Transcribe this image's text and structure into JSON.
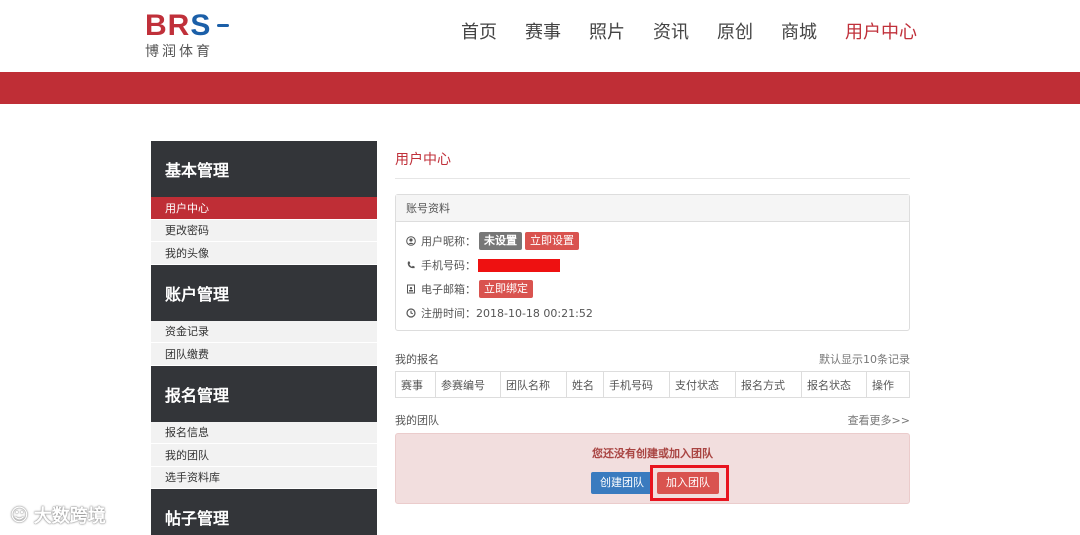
{
  "header": {
    "logo": {
      "mark": "BRS",
      "subtitle": "博润体育"
    },
    "nav": [
      {
        "label": "首页"
      },
      {
        "label": "赛事"
      },
      {
        "label": "照片"
      },
      {
        "label": "资讯"
      },
      {
        "label": "原创"
      },
      {
        "label": "商城"
      },
      {
        "label": "用户中心",
        "active": true
      }
    ]
  },
  "sidebar": {
    "groups": [
      {
        "title": "基本管理",
        "items": [
          "用户中心",
          "更改密码",
          "我的头像"
        ]
      },
      {
        "title": "账户管理",
        "items": [
          "资金记录",
          "团队缴费"
        ]
      },
      {
        "title": "报名管理",
        "items": [
          "报名信息",
          "我的团队",
          "选手资料库"
        ]
      },
      {
        "title": "帖子管理",
        "items": []
      }
    ]
  },
  "main": {
    "title": "用户中心",
    "account": {
      "header": "账号资料",
      "nickname_label": "用户昵称：",
      "nickname_value": "未设置",
      "nickname_action": "立即设置",
      "phone_label": "手机号码：",
      "email_label": "电子邮箱：",
      "email_action": "立即绑定",
      "register_label": "注册时间：",
      "register_value": "2018-10-18 00:21:52"
    },
    "registrations": {
      "title": "我的报名",
      "note": "默认显示10条记录",
      "columns": [
        "赛事",
        "参赛编号",
        "团队名称",
        "姓名",
        "手机号码",
        "支付状态",
        "报名方式",
        "报名状态",
        "操作"
      ]
    },
    "team": {
      "title": "我的团队",
      "more": "查看更多>>",
      "empty_message": "您还没有创建或加入团队",
      "create_button": "创建团队",
      "join_button": "加入团队"
    }
  },
  "watermark": {
    "text": "大数跨境"
  },
  "colors": {
    "brand_red": "#bf2e36",
    "sidebar_dark": "#333539",
    "button_blue": "#3a7bbf",
    "button_red": "#d9534f"
  }
}
